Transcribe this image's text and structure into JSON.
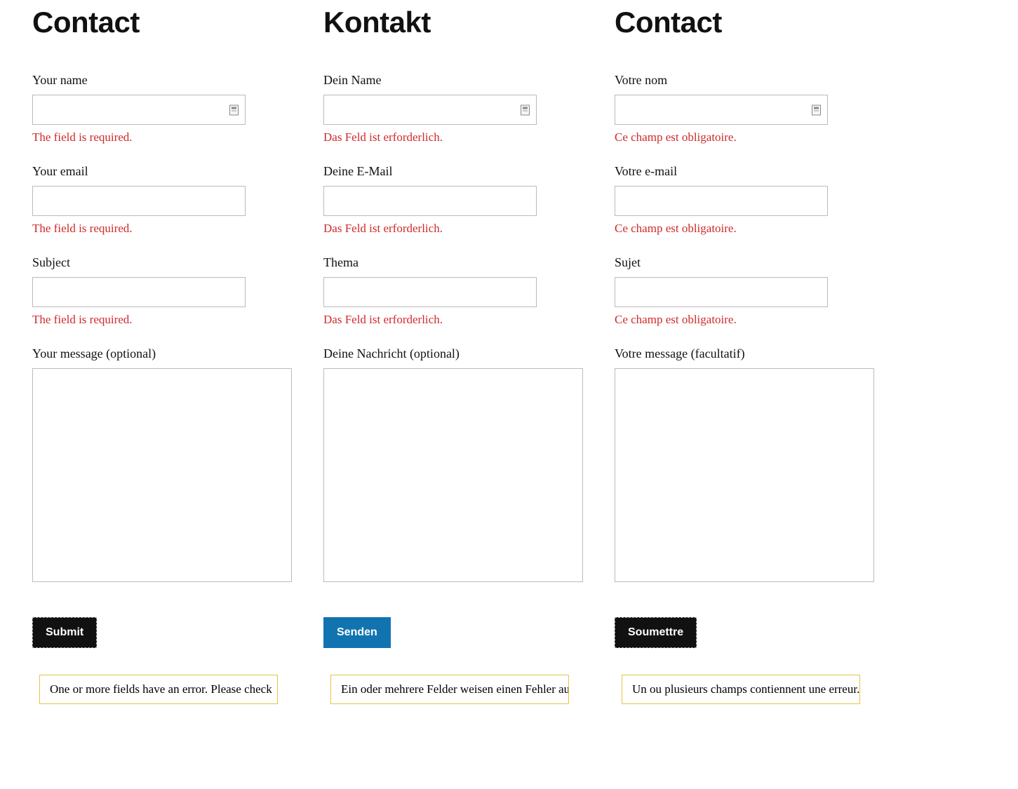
{
  "columns": {
    "en": {
      "title": "Contact",
      "name_label": "Your name",
      "name_error": "The field is required.",
      "email_label": "Your email",
      "email_error": "The field is required.",
      "subject_label": "Subject",
      "subject_error": "The field is required.",
      "message_label": "Your message (optional)",
      "submit_label": "Submit",
      "alert": "One or more fields have an error. Please check"
    },
    "de": {
      "title": "Kontakt",
      "name_label": "Dein Name",
      "name_error": "Das Feld ist erforderlich.",
      "email_label": "Deine E-Mail",
      "email_error": "Das Feld ist erforderlich.",
      "subject_label": "Thema",
      "subject_error": "Das Feld ist erforderlich.",
      "message_label": "Deine Nachricht (optional)",
      "submit_label": "Senden",
      "alert": "Ein oder mehrere Felder weisen einen Fehler auf. Bitt"
    },
    "fr": {
      "title": "Contact",
      "name_label": "Votre nom",
      "name_error": "Ce champ est obligatoire.",
      "email_label": "Votre e-mail",
      "email_error": "Ce champ est obligatoire.",
      "subject_label": "Sujet",
      "subject_error": "Ce champ est obligatoire.",
      "message_label": "Votre message (facultatif)",
      "submit_label": "Soumettre",
      "alert": "Un ou plusieurs champs contiennent une erreur. Veuille"
    }
  },
  "colors": {
    "error": "#d02a2a",
    "alert_border": "#e6c448",
    "submit_black": "#111111",
    "submit_blue": "#1174b0"
  }
}
